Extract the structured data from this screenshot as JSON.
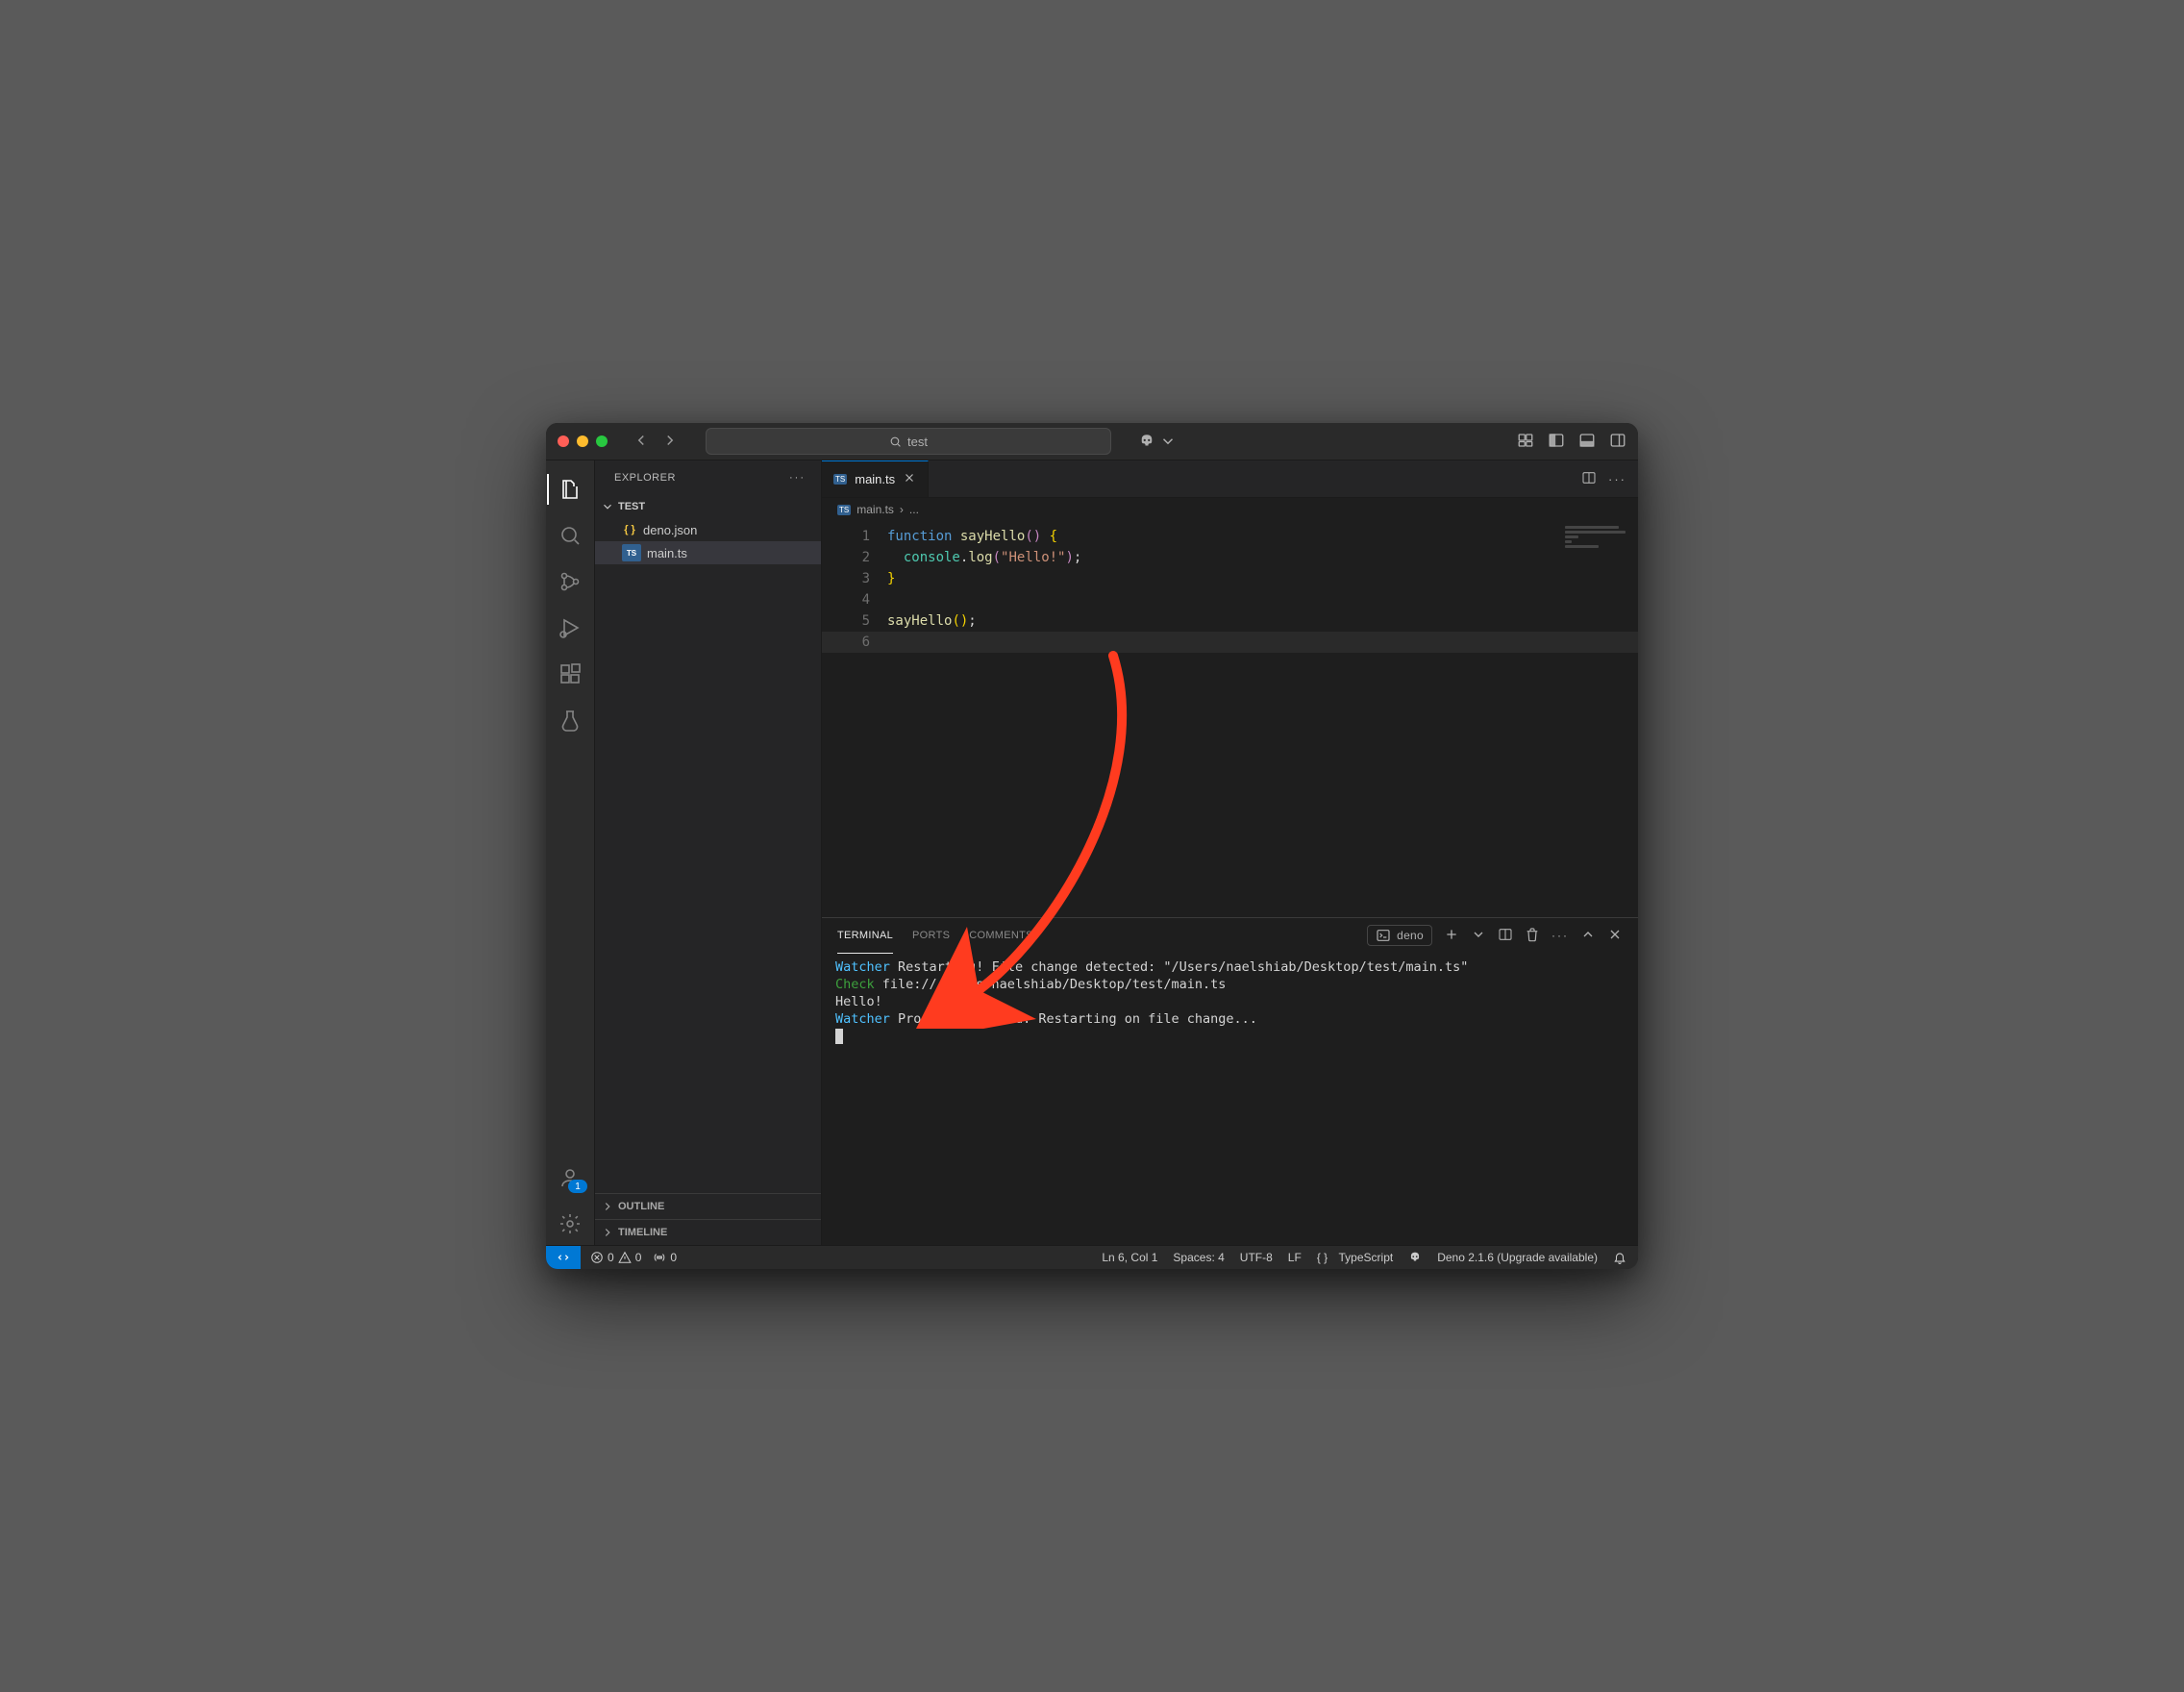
{
  "titlebar": {
    "search_label": "test"
  },
  "explorer": {
    "title": "EXPLORER",
    "section_label": "TEST",
    "outline_label": "OUTLINE",
    "timeline_label": "TIMELINE",
    "files": [
      {
        "icon": "json",
        "icon_glyph": "{ }",
        "name": "deno.json"
      },
      {
        "icon": "ts",
        "icon_glyph": "TS",
        "name": "main.ts",
        "selected": true
      }
    ]
  },
  "activity": {
    "account_badge": "1"
  },
  "tab": {
    "icon_glyph": "TS",
    "label": "main.ts"
  },
  "breadcrumb": {
    "icon_glyph": "TS",
    "file": "main.ts",
    "sep": "›",
    "rest": "..."
  },
  "editor": {
    "lines": [
      {
        "n": "1",
        "html": "<span class='kw'>function</span> <span class='fn'>sayHello</span><span class='paren0'>()</span> <span class='brace0'>{</span>"
      },
      {
        "n": "2",
        "html": "  <span class='obj'>console</span>.<span class='fn'>log</span><span class='paren0'>(</span><span class='str'>\"Hello!\"</span><span class='paren0'>)</span>;"
      },
      {
        "n": "3",
        "html": "<span class='brace0'>}</span>"
      },
      {
        "n": "4",
        "html": ""
      },
      {
        "n": "5",
        "html": "<span class='fn'>sayHello</span><span class='brace0'>()</span>;"
      },
      {
        "n": "6",
        "html": "",
        "hl": true
      }
    ]
  },
  "panel": {
    "tabs": {
      "terminal": "TERMINAL",
      "ports": "PORTS",
      "comments": "COMMENTS"
    },
    "profile": "deno"
  },
  "terminal": {
    "lines": [
      {
        "prefix": "Watcher",
        "prefix_class": "t-cyan",
        "text": " Restarting! File change detected: \"/Users/naelshiab/Desktop/test/main.ts\""
      },
      {
        "prefix": "Check",
        "prefix_class": "t-green",
        "text": " file:///Users/naelshiab/Desktop/test/main.ts"
      },
      {
        "prefix": "",
        "prefix_class": "",
        "text": "Hello!"
      },
      {
        "prefix": "Watcher",
        "prefix_class": "t-cyan",
        "text": " Process finished. Restarting on file change..."
      }
    ]
  },
  "status": {
    "errors": "0",
    "warnings": "0",
    "ports": "0",
    "cursor": "Ln 6, Col 1",
    "spaces": "Spaces: 4",
    "encoding": "UTF-8",
    "eol": "LF",
    "lang_glyph": "{ }",
    "lang": "TypeScript",
    "deno": "Deno 2.1.6 (Upgrade available)"
  }
}
